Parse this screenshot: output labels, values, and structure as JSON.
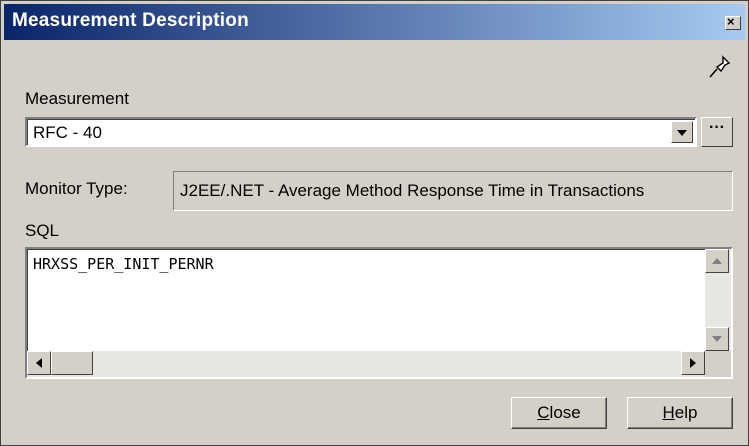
{
  "window": {
    "title": "Measurement Description",
    "close_glyph": "×"
  },
  "icons": {
    "pin": "pushpin-icon",
    "close": "close-icon",
    "dropdown": "chevron-down-icon"
  },
  "measurement": {
    "label": "Measurement",
    "value": "RFC - 40",
    "more_button": "···"
  },
  "monitor_type": {
    "label": "Monitor Type:",
    "value": "J2EE/.NET - Average Method Response Time in Transactions"
  },
  "sql": {
    "label": "SQL",
    "value": "HRXSS_PER_INIT_PERNR"
  },
  "buttons": {
    "close_prefix": "",
    "close_mnemonic": "C",
    "close_rest": "lose",
    "help_mnemonic": "H",
    "help_rest": "elp"
  },
  "colors": {
    "title_start": "#0a246a",
    "title_end": "#a6caf0",
    "face": "#d4d0c8"
  }
}
